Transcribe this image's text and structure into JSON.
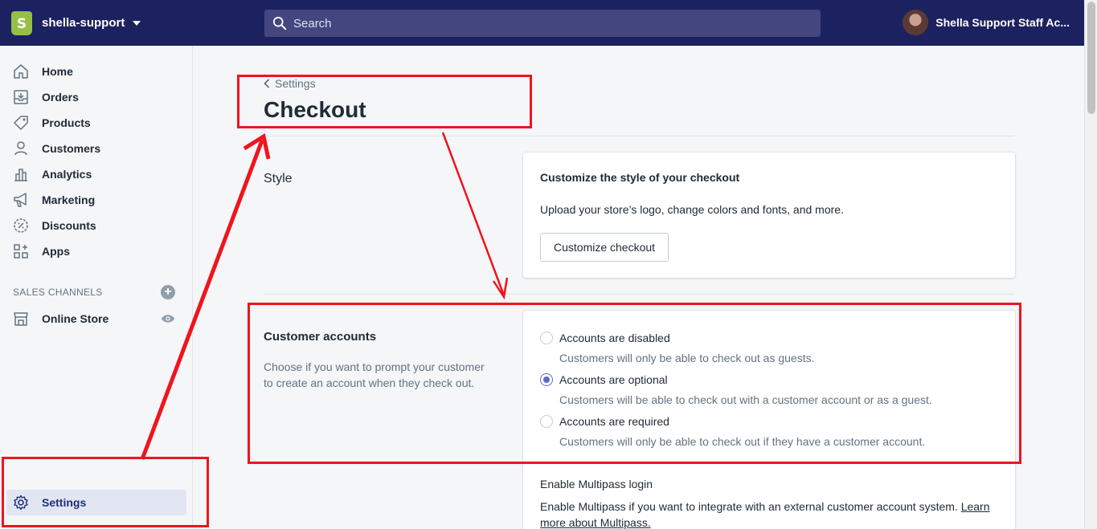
{
  "topbar": {
    "store_logo_letter": "S",
    "store_name": "shella-support",
    "search_placeholder": "Search",
    "account_name": "Shella Support Staff Ac..."
  },
  "sidebar": {
    "items": [
      {
        "label": "Home",
        "icon": "home-icon"
      },
      {
        "label": "Orders",
        "icon": "orders-icon"
      },
      {
        "label": "Products",
        "icon": "tag-icon"
      },
      {
        "label": "Customers",
        "icon": "person-icon"
      },
      {
        "label": "Analytics",
        "icon": "bar-chart-icon"
      },
      {
        "label": "Marketing",
        "icon": "megaphone-icon"
      },
      {
        "label": "Discounts",
        "icon": "discount-icon"
      },
      {
        "label": "Apps",
        "icon": "apps-icon"
      }
    ],
    "sales_channels_title": "SALES CHANNELS",
    "online_store_label": "Online Store",
    "settings_label": "Settings"
  },
  "page": {
    "breadcrumb": "Settings",
    "title": "Checkout"
  },
  "style_section": {
    "title": "Style",
    "card_title": "Customize the style of your checkout",
    "card_text": "Upload your store’s logo, change colors and fonts, and more.",
    "button_label": "Customize checkout"
  },
  "accounts_section": {
    "title": "Customer accounts",
    "description": "Choose if you want to prompt your customer to create an account when they check out.",
    "options": [
      {
        "label": "Accounts are disabled",
        "help": "Customers will only be able to check out as guests.",
        "checked": false
      },
      {
        "label": "Accounts are optional",
        "help": "Customers will be able to check out with a customer account or as a guest.",
        "checked": true
      },
      {
        "label": "Accounts are required",
        "help": "Customers will only be able to check out if they have a customer account.",
        "checked": false
      }
    ],
    "multipass_title": "Enable Multipass login",
    "multipass_text": "Enable Multipass if you want to integrate with an external customer account system.",
    "multipass_link_1": "Learn",
    "multipass_link_2": "more about Multipass."
  },
  "colors": {
    "topbar": "#1c2260",
    "accent": "#5c6ac4",
    "annotation": "#f0141e"
  }
}
